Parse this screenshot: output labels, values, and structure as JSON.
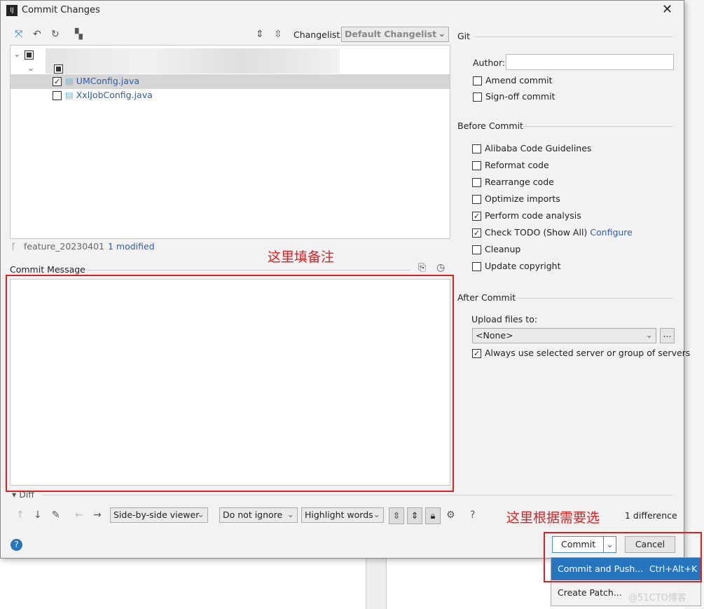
{
  "window": {
    "title": "Commit Changes"
  },
  "toolbar": {
    "changelist_label": "Changelist:",
    "changelist_value": "Default Changelist"
  },
  "tree": {
    "files": [
      {
        "name": "UMConfig.java",
        "checked": true
      },
      {
        "name": "XxlJobConfig.java",
        "checked": false
      }
    ]
  },
  "status": {
    "branch": "feature_20230401",
    "modified": "1 modified"
  },
  "commit_message": {
    "label": "Commit Message",
    "value": ""
  },
  "annotations": {
    "message": "这里填备注",
    "choose": "这里根据需要选",
    "watermark": "@51CTO博客"
  },
  "git": {
    "title": "Git",
    "author_label": "Author:",
    "author_value": "",
    "amend": "Amend commit",
    "signoff": "Sign-off commit"
  },
  "before_commit": {
    "title": "Before Commit",
    "items": [
      {
        "label": "Alibaba Code Guidelines",
        "checked": false
      },
      {
        "label": "Reformat code",
        "checked": false
      },
      {
        "label": "Rearrange code",
        "checked": false
      },
      {
        "label": "Optimize imports",
        "checked": false
      },
      {
        "label": "Perform code analysis",
        "checked": true
      },
      {
        "label": "Check TODO (Show All)",
        "checked": true
      },
      {
        "label": "Cleanup",
        "checked": false
      },
      {
        "label": "Update copyright",
        "checked": false
      }
    ],
    "configure_link": "Configure"
  },
  "after_commit": {
    "title": "After Commit",
    "upload_label": "Upload files to:",
    "upload_value": "<None>",
    "browse": "...",
    "always_use": "Always use selected server or group of servers"
  },
  "diff": {
    "title": "Diff",
    "viewer": "Side-by-side viewer",
    "ignore": "Do not ignore",
    "highlight": "Highlight words",
    "differences": "1 difference"
  },
  "buttons": {
    "commit": "Commit",
    "cancel": "Cancel"
  },
  "commit_menu": {
    "items": [
      {
        "label": "Commit and Push...",
        "shortcut": "Ctrl+Alt+K"
      },
      {
        "label": "Create Patch...",
        "shortcut": ""
      }
    ]
  },
  "colors": {
    "accent": "#2675bf",
    "link": "#2a5db0",
    "annotation": "#e02020"
  }
}
